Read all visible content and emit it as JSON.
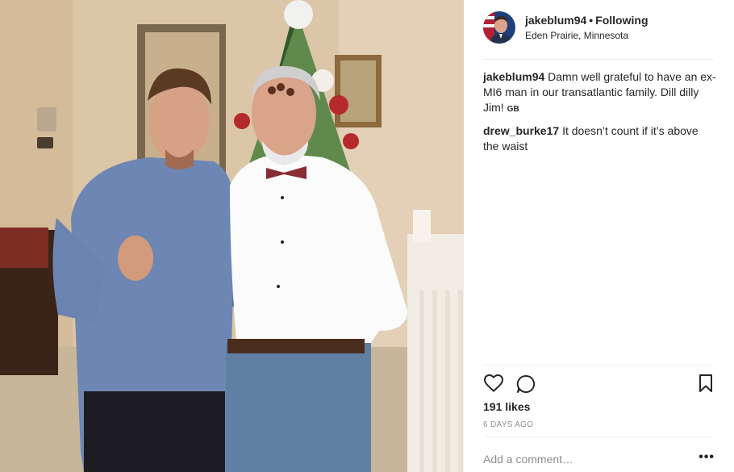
{
  "post": {
    "username": "jakeblum94",
    "separator": "•",
    "follow_status": "Following",
    "location": "Eden Prairie, Minnesota",
    "photo_icon": "photo-of-two-men"
  },
  "comments": [
    {
      "user": "jakeblum94",
      "text": "Damn well grateful to have an ex-MI6 man in our transatlantic family. Dill dilly Jim!",
      "flag": "GB"
    },
    {
      "user": "drew_burke17",
      "text": "It doesn’t count if it’s above the waist"
    }
  ],
  "actions": {
    "like_icon": "heart-icon",
    "comment_icon": "comment-icon",
    "save_icon": "bookmark-icon"
  },
  "likes": "191 likes",
  "time_ago": "6 DAYS AGO",
  "add_comment": {
    "placeholder": "Add a comment…",
    "more_label": "•••"
  },
  "colors": {
    "text": "#262626",
    "muted": "#8e8e8e",
    "divider": "#efefef"
  }
}
